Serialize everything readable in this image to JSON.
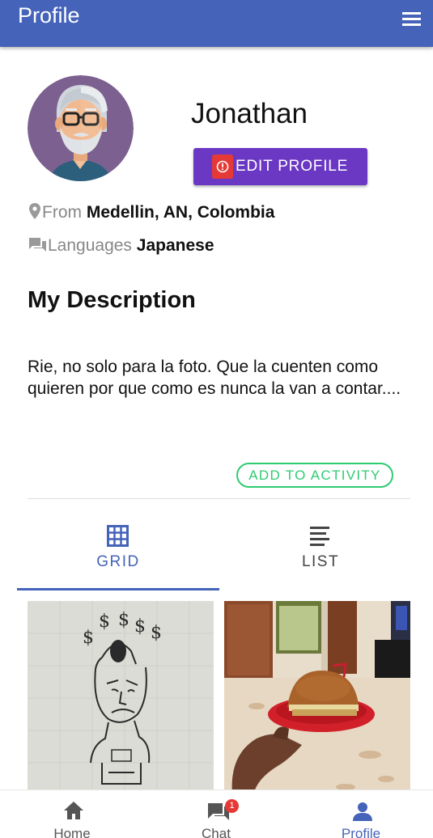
{
  "appbar": {
    "title": "Profile",
    "menu_icon": "hamburger-menu-icon"
  },
  "profile": {
    "name": "Jonathan",
    "edit_button_label": "EDIT PROFILE",
    "from_label": "From",
    "from_value": "Medellin, AN, Colombia",
    "languages_label": "Languages",
    "languages_value": "Japanese"
  },
  "description": {
    "title": "My Description",
    "text": "Rie, no solo para la foto. Que la cuenten como quieren por que como es nunca la van a contar...."
  },
  "activity_button_label": "ADD TO ACTIVITY",
  "tabs": [
    {
      "label": "GRID",
      "icon": "grid-icon",
      "active": true
    },
    {
      "label": "LIST",
      "icon": "list-icon",
      "active": false
    }
  ],
  "photos": [
    {
      "alt": "pencil drawing"
    },
    {
      "alt": "burger photo"
    }
  ],
  "bottom_nav": [
    {
      "label": "Home",
      "icon": "home-icon"
    },
    {
      "label": "Chat",
      "icon": "chat-icon",
      "badge": "1"
    },
    {
      "label": "Profile",
      "icon": "person-icon",
      "active": true
    }
  ],
  "colors": {
    "primary": "#4563b9",
    "edit_button": "#6b38c4",
    "accent_green": "#2ecc71",
    "badge_red": "#e53935"
  }
}
